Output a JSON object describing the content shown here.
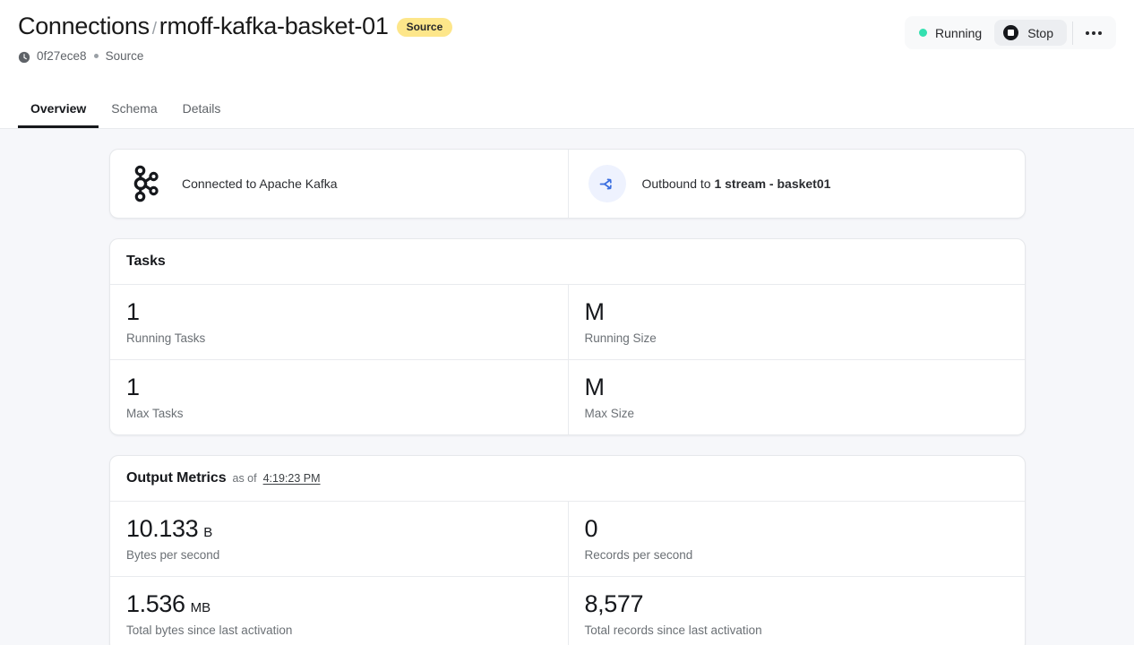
{
  "header": {
    "breadcrumb_parent": "Connections",
    "breadcrumb_separator": "/",
    "breadcrumb_current": "rmoff-kafka-basket-01",
    "badge": "Source",
    "subtitle_id": "0f27ece8",
    "subtitle_type": "Source",
    "clock_icon": "clock-icon",
    "status_label": "Running",
    "status_color": "#34e0b0",
    "stop_label": "Stop",
    "stop_icon": "stop-icon",
    "more_icon": "ellipsis-icon"
  },
  "tabs": [
    {
      "label": "Overview",
      "active": true
    },
    {
      "label": "Schema",
      "active": false
    },
    {
      "label": "Details",
      "active": false
    }
  ],
  "connection": {
    "inbound": {
      "icon": "apache-kafka-logo",
      "label": "Connected to Apache Kafka"
    },
    "outbound": {
      "icon": "shuffle-arrow-icon",
      "icon_bg": "#eef2fe",
      "icon_color": "#3b6fe0",
      "prefix": "Outbound to ",
      "target": "1 stream - basket01"
    }
  },
  "tasks": {
    "title": "Tasks",
    "rows": [
      [
        {
          "value": "1",
          "unit": "",
          "label": "Running Tasks"
        },
        {
          "value": "M",
          "unit": "",
          "label": "Running Size"
        }
      ],
      [
        {
          "value": "1",
          "unit": "",
          "label": "Max Tasks"
        },
        {
          "value": "M",
          "unit": "",
          "label": "Max Size"
        }
      ]
    ]
  },
  "output_metrics": {
    "title": "Output Metrics",
    "asof_prefix": "as of",
    "asof_time": "4:19:23 PM",
    "rows": [
      [
        {
          "value": "10.133",
          "unit": "B",
          "label": "Bytes per second"
        },
        {
          "value": "0",
          "unit": "",
          "label": "Records per second"
        }
      ],
      [
        {
          "value": "1.536",
          "unit": "MB",
          "label": "Total bytes since last activation"
        },
        {
          "value": "8,577",
          "unit": "",
          "label": "Total records since last activation"
        }
      ]
    ]
  }
}
